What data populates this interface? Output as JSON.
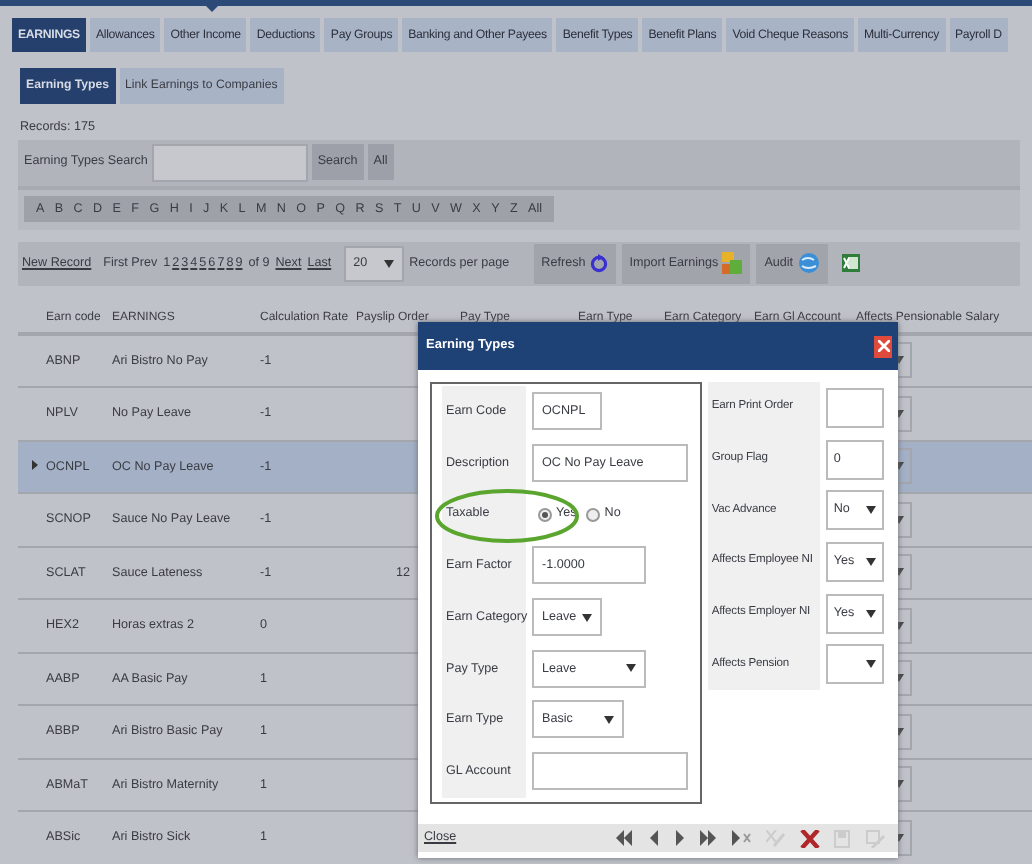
{
  "top_tabs": [
    {
      "label": "EARNINGS",
      "selected": true
    },
    {
      "label": "Allowances",
      "selected": false
    },
    {
      "label": "Other Income",
      "selected": false
    },
    {
      "label": "Deductions",
      "selected": false
    },
    {
      "label": "Pay Groups",
      "selected": false
    },
    {
      "label": "Banking and Other Payees",
      "selected": false
    },
    {
      "label": "Benefit Types",
      "selected": false
    },
    {
      "label": "Benefit Plans",
      "selected": false
    },
    {
      "label": "Void Cheque Reasons",
      "selected": false
    },
    {
      "label": "Multi-Currency",
      "selected": false
    },
    {
      "label": "Payroll D",
      "selected": false
    }
  ],
  "sub_tabs": [
    {
      "label": "Earning Types",
      "selected": true
    },
    {
      "label": "Link Earnings to Companies",
      "selected": false
    }
  ],
  "records": {
    "label": "Records:",
    "count": "175"
  },
  "search": {
    "label": "Earning Types Search",
    "button": "Search",
    "all_button": "All"
  },
  "letters": [
    "A",
    "B",
    "C",
    "D",
    "E",
    "F",
    "G",
    "H",
    "I",
    "J",
    "K",
    "L",
    "M",
    "N",
    "O",
    "P",
    "Q",
    "R",
    "S",
    "T",
    "U",
    "V",
    "W",
    "X",
    "Y",
    "Z",
    "All"
  ],
  "pager": {
    "new_record": "New Record",
    "first": "First",
    "prev": "Prev",
    "pages": [
      {
        "label": "1",
        "selected": true
      },
      {
        "label": "2",
        "selected": false
      },
      {
        "label": "3",
        "selected": false
      },
      {
        "label": "4",
        "selected": false
      },
      {
        "label": "5",
        "selected": false
      },
      {
        "label": "6",
        "selected": false
      },
      {
        "label": "7",
        "selected": false
      },
      {
        "label": "8",
        "selected": false
      },
      {
        "label": "9",
        "selected": false
      }
    ],
    "of": "of 9",
    "next": "Next",
    "last": "Last",
    "page_size": "20",
    "per_page": "Records per page"
  },
  "toolbar": {
    "refresh": "Refresh",
    "import": "Import Earnings",
    "audit": "Audit"
  },
  "table": {
    "columns": [
      "Earn code",
      "EARNINGS",
      "Calculation Rate",
      "Payslip Order",
      "Pay Type",
      "Earn Type",
      "Earn Category",
      "Earn Gl Account",
      "Affects Pensionable Salary"
    ],
    "rows": [
      {
        "code": "ABNP",
        "name": "Ari Bistro No Pay",
        "rate": "-1",
        "payslip_order": "",
        "selected": false
      },
      {
        "code": "NPLV",
        "name": "No Pay Leave",
        "rate": "-1",
        "payslip_order": "",
        "selected": false
      },
      {
        "code": "OCNPL",
        "name": "OC No Pay Leave",
        "rate": "-1",
        "payslip_order": "",
        "selected": true
      },
      {
        "code": "SCNOP",
        "name": "Sauce No Pay Leave",
        "rate": "-1",
        "payslip_order": "",
        "selected": false
      },
      {
        "code": "SCLAT",
        "name": "Sauce Lateness",
        "rate": "-1",
        "payslip_order": "12",
        "selected": false
      },
      {
        "code": "HEX2",
        "name": "Horas extras 2",
        "rate": "0",
        "payslip_order": "",
        "selected": false
      },
      {
        "code": "AABP",
        "name": "AA Basic Pay",
        "rate": "1",
        "payslip_order": "",
        "selected": false
      },
      {
        "code": "ABBP",
        "name": "Ari Bistro Basic Pay",
        "rate": "1",
        "payslip_order": "",
        "selected": false
      },
      {
        "code": "ABMaT",
        "name": "Ari Bistro Maternity",
        "rate": "1",
        "payslip_order": "",
        "selected": false
      },
      {
        "code": "ABSic",
        "name": "Ari Bistro Sick",
        "rate": "1",
        "payslip_order": "",
        "selected": false
      }
    ]
  },
  "dialog": {
    "title": "Earning Types",
    "left_fields": [
      {
        "label": "Earn Code",
        "kind": "text",
        "value": "OCNPL"
      },
      {
        "label": "Description",
        "kind": "text",
        "value": "OC No Pay Leave"
      },
      {
        "label": "Taxable",
        "kind": "radio",
        "options": [
          {
            "label": "Yes",
            "selected": true
          },
          {
            "label": "No",
            "selected": false
          }
        ]
      },
      {
        "label": "Earn Factor",
        "kind": "text",
        "value": "-1.0000"
      },
      {
        "label": "Earn Category",
        "kind": "select",
        "value": "Leave"
      },
      {
        "label": "Pay Type",
        "kind": "select",
        "value": "Leave"
      },
      {
        "label": "Earn Type",
        "kind": "select",
        "value": "Basic"
      },
      {
        "label": "GL Account",
        "kind": "text"
      }
    ],
    "right_fields": [
      {
        "label": "Earn Print Order",
        "kind": "text"
      },
      {
        "label": "Group Flag",
        "kind": "text",
        "value": "0"
      },
      {
        "label": "Vac Advance",
        "kind": "select",
        "value": "No"
      },
      {
        "label": "Affects Employee NI",
        "kind": "select",
        "value": "Yes"
      },
      {
        "label": "Affects Employer NI",
        "kind": "select",
        "value": "Yes"
      },
      {
        "label": "Affects Pension",
        "kind": "select"
      }
    ],
    "close": "Close"
  }
}
